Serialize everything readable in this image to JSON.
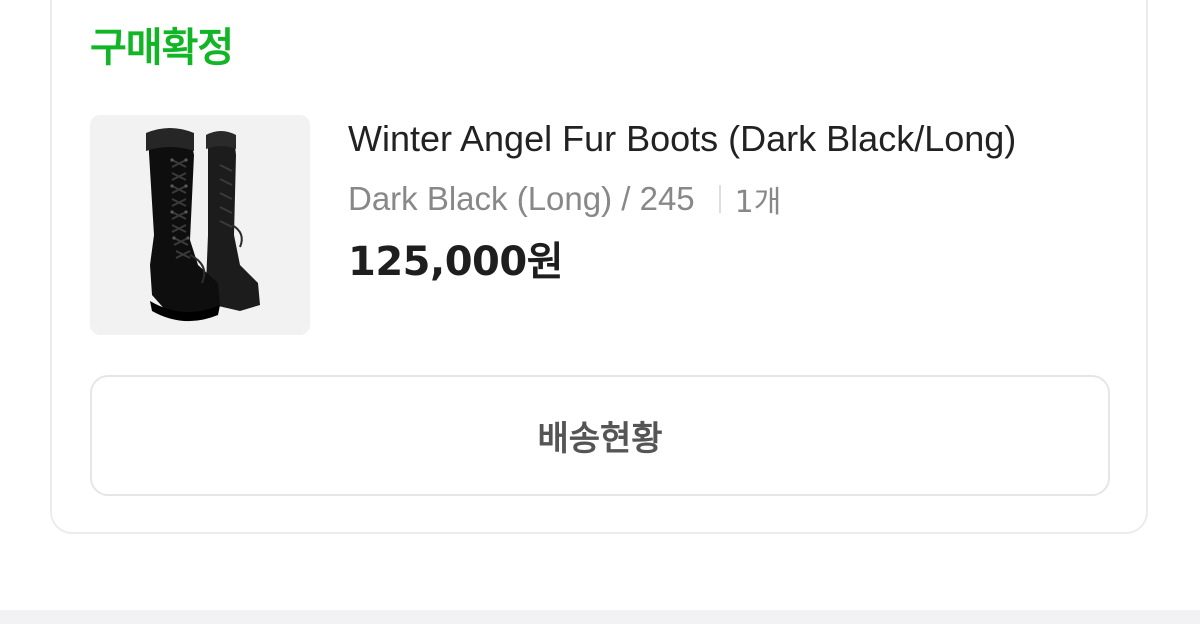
{
  "order": {
    "status_label": "구매확정",
    "status_color": "#12b526"
  },
  "product": {
    "image_icon": "fur-boots-image",
    "name": "Winter Angel Fur Boots (Dark Black/Long)",
    "option": "Dark Black (Long) / 245",
    "quantity": "1개",
    "price": "125,000원"
  },
  "actions": {
    "shipping_status_label": "배송현황"
  }
}
